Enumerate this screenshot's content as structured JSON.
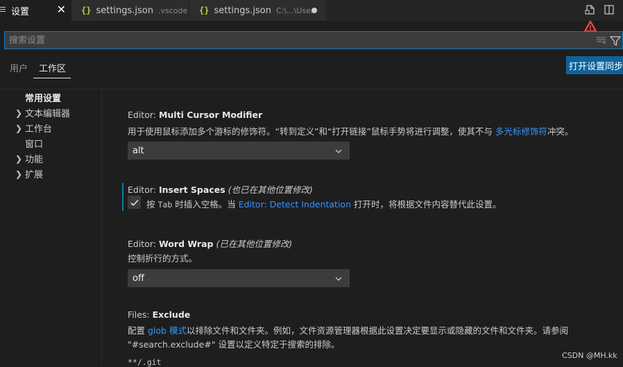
{
  "tabs": [
    {
      "label": "设置",
      "icon": "list-settings-icon"
    },
    {
      "label": "settings.json",
      "desc": ".vscode",
      "icon": "json-braces-icon"
    },
    {
      "label": "settings.json",
      "desc": "C:\\...\\User",
      "icon": "json-braces-icon",
      "dirty": true
    }
  ],
  "tab_braces": "{}",
  "search": {
    "placeholder": "搜索设置"
  },
  "scope": {
    "user": "用户",
    "workspace": "工作区",
    "sync_button": "打开设置同步"
  },
  "toc": [
    {
      "label": "常用设置",
      "expandable": false,
      "selected": true
    },
    {
      "label": "文本编辑器",
      "expandable": true
    },
    {
      "label": "工作台",
      "expandable": true
    },
    {
      "label": "窗口",
      "expandable": false
    },
    {
      "label": "功能",
      "expandable": true
    },
    {
      "label": "扩展",
      "expandable": true
    }
  ],
  "settings": {
    "multi_cursor": {
      "category": "Editor: ",
      "name": "Multi Cursor Modifier",
      "desc_a": "用于使用鼠标添加多个游标的修饰符。“转到定义”和“打开链接”鼠标手势将进行调整，使其不与 ",
      "desc_link": "多光标修饰符",
      "desc_b": "冲突。",
      "value": "alt"
    },
    "insert_spaces": {
      "category": "Editor: ",
      "name": "Insert Spaces",
      "modified": "(也已在其他位置修改)",
      "desc_a": "按 ",
      "desc_code": "Tab",
      "desc_b": " 时插入空格。当 ",
      "desc_link": "Editor: Detect Indentation",
      "desc_c": " 打开时，将根据文件内容替代此设置。",
      "checked": true
    },
    "word_wrap": {
      "category": "Editor: ",
      "name": "Word Wrap",
      "modified": "(已在其他位置修改)",
      "desc": "控制折行的方式。",
      "value": "off"
    },
    "files_exclude": {
      "category": "Files: ",
      "name": "Exclude",
      "desc_a": "配置 ",
      "desc_link": "glob 模式",
      "desc_b": "以排除文件和文件夹。例如，文件资源管理器根据此设置决定要显示或隐藏的文件和文件夹。请参阅",
      "desc_line2": "\"#search.exclude#\" 设置以定义特定于搜索的排除。",
      "first_pattern": "**/.git"
    }
  },
  "watermark": "CSDN @MH.kk",
  "colors": {
    "accent": "#007fd4",
    "link": "#3794ff",
    "button": "#0e639c",
    "warning": "#f14c4c"
  }
}
